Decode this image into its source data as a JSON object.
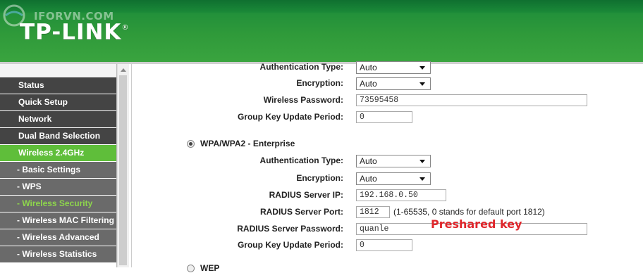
{
  "header": {
    "brand": "TP-LINK",
    "trademark": "®",
    "watermark": "IFORVN.COM"
  },
  "sidebar": {
    "items": [
      {
        "label": "Status",
        "type": "main"
      },
      {
        "label": "Quick Setup",
        "type": "main"
      },
      {
        "label": "Network",
        "type": "main"
      },
      {
        "label": "Dual Band Selection",
        "type": "main"
      },
      {
        "label": "Wireless 2.4GHz",
        "type": "active"
      },
      {
        "label": "- Basic Settings",
        "type": "sub"
      },
      {
        "label": "- WPS",
        "type": "sub"
      },
      {
        "label": "- Wireless Security",
        "type": "current"
      },
      {
        "label": "- Wireless MAC Filtering",
        "type": "sub"
      },
      {
        "label": "- Wireless Advanced",
        "type": "sub"
      },
      {
        "label": "- Wireless Statistics",
        "type": "sub"
      }
    ]
  },
  "personal": {
    "auth_label": "Authentication Type:",
    "auth_value": "Auto",
    "enc_label": "Encryption:",
    "enc_value": "Auto",
    "pwd_label": "Wireless Password:",
    "pwd_value": "73595458",
    "gkup_label": "Group Key Update Period:",
    "gkup_value": "0"
  },
  "enterprise": {
    "title": "WPA/WPA2 - Enterprise",
    "auth_label": "Authentication Type:",
    "auth_value": "Auto",
    "enc_label": "Encryption:",
    "enc_value": "Auto",
    "ip_label": "RADIUS Server IP:",
    "ip_value": "192.168.0.50",
    "port_label": "RADIUS Server Port:",
    "port_value": "1812",
    "port_note": "(1-65535, 0 stands for default port 1812)",
    "rpwd_label": "RADIUS Server Password:",
    "rpwd_value": "quanle",
    "gkup_label": "Group Key Update Period:",
    "gkup_value": "0"
  },
  "next_section": {
    "title": "WEP"
  },
  "annotation": "Preshared key",
  "colors": {
    "header_green": "#2f9a3a",
    "active_green": "#5fbe3a",
    "menu_dark": "#444444",
    "annotation_red": "#e0262b"
  }
}
